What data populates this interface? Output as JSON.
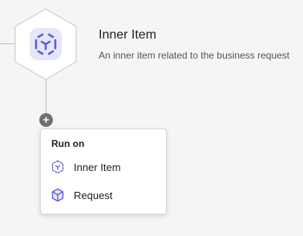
{
  "node": {
    "title": "Inner Item",
    "description": "An inner item related to the business request",
    "icon": "dashed-cube-icon"
  },
  "add_button": {
    "symbol": "+"
  },
  "run_on_menu": {
    "heading": "Run on",
    "items": [
      {
        "label": "Inner Item",
        "icon": "dashed-cube-icon"
      },
      {
        "label": "Request",
        "icon": "cube-icon"
      }
    ]
  },
  "colors": {
    "accent": "#5b5fd9",
    "icon_bg": "#e6e6f8",
    "background": "#f5f5f4",
    "add_button": "#707070"
  }
}
